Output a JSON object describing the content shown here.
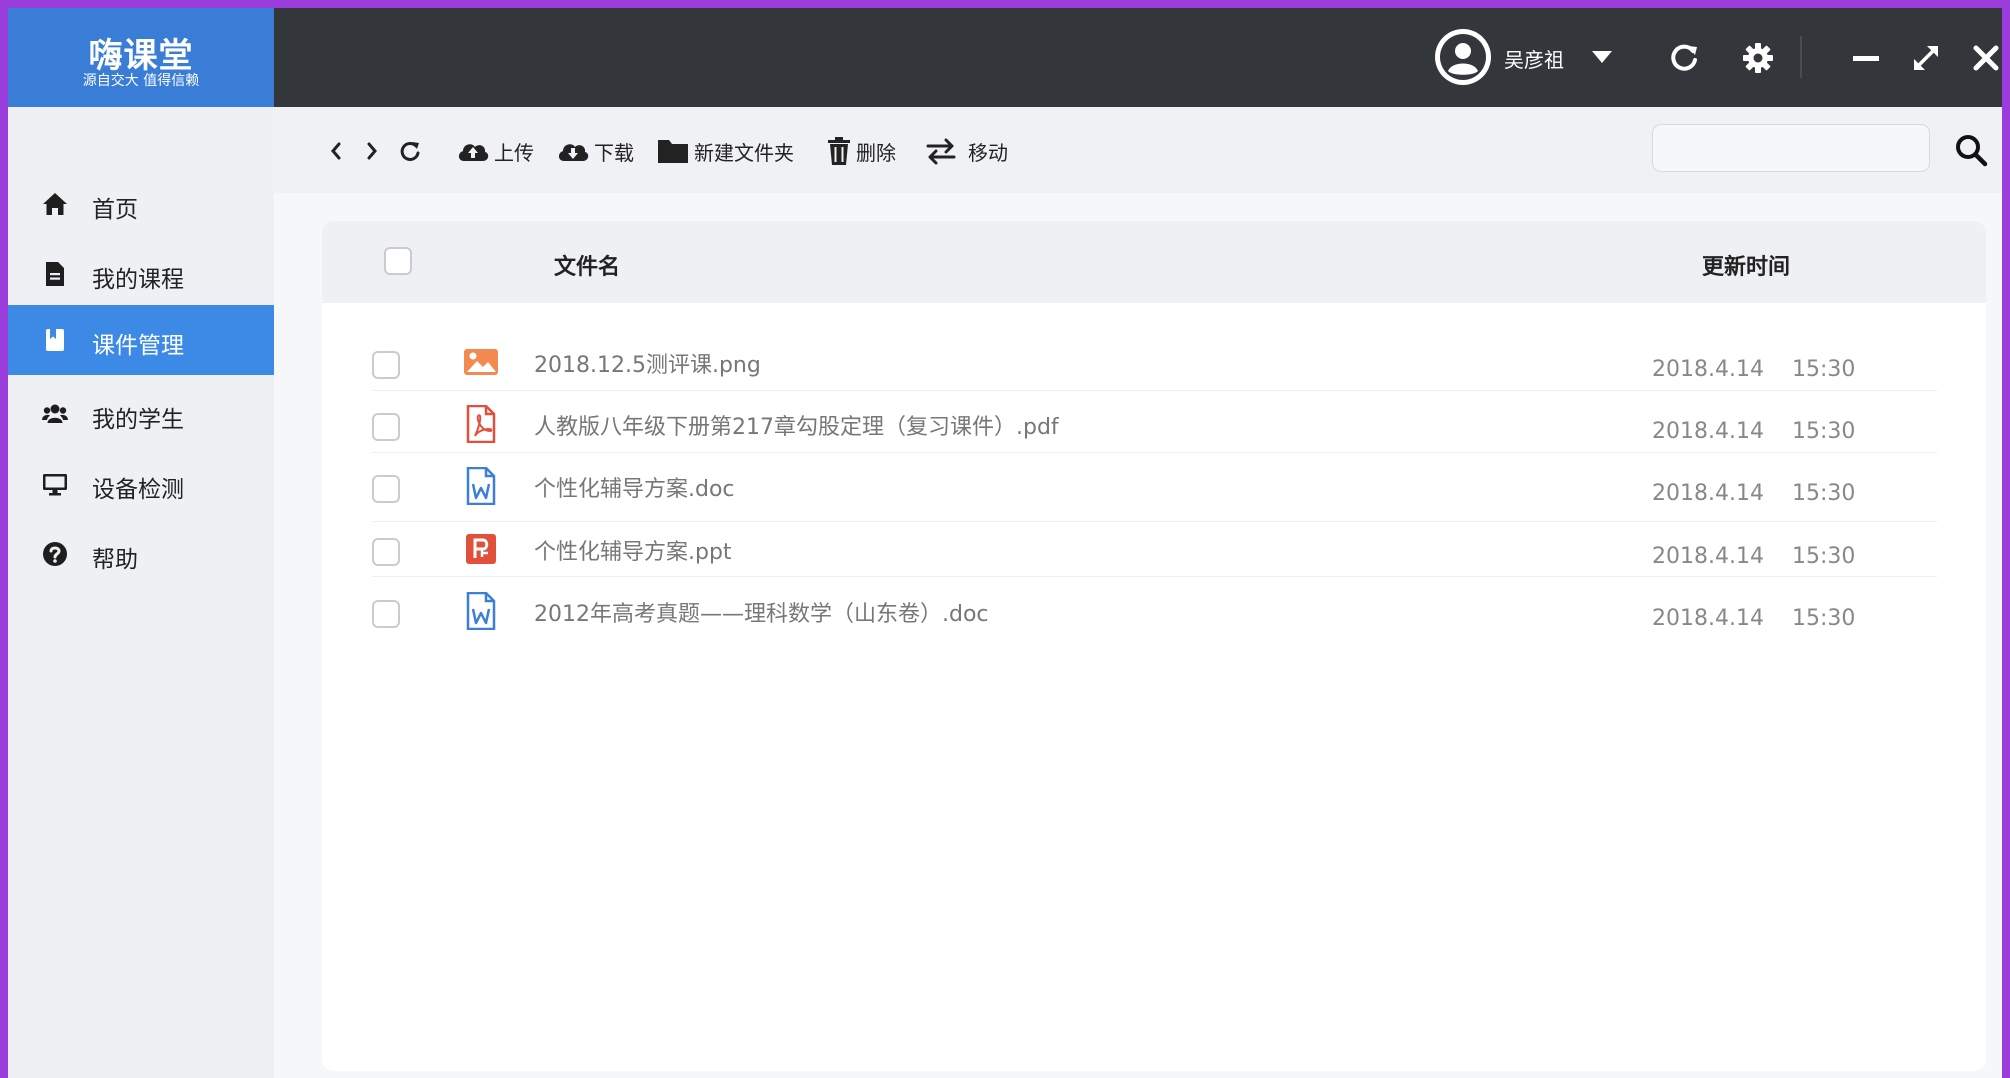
{
  "app": {
    "logo_title": "嗨课堂",
    "logo_subtitle": "源自交大 值得信赖",
    "brand_color": "#3a7dd6",
    "topbar_color": "#33363b",
    "accent_active": "#3d8ae6"
  },
  "header": {
    "user_name": "吴彦祖",
    "icons": [
      "user-avatar-icon",
      "chevron-down-icon",
      "refresh-icon",
      "gear-icon",
      "minimize-icon",
      "expand-icon",
      "close-icon"
    ]
  },
  "sidebar": {
    "items": [
      {
        "label": "首页",
        "icon": "home-icon",
        "active": false
      },
      {
        "label": "我的课程",
        "icon": "document-icon",
        "active": false
      },
      {
        "label": "课件管理",
        "icon": "bookmark-icon",
        "active": true
      },
      {
        "label": "我的学生",
        "icon": "users-icon",
        "active": false
      },
      {
        "label": "设备检测",
        "icon": "monitor-icon",
        "active": false
      },
      {
        "label": "帮助",
        "icon": "help-icon",
        "active": false
      }
    ]
  },
  "toolbar": {
    "upload_label": "上传",
    "download_label": "下载",
    "new_folder_label": "新建文件夹",
    "delete_label": "删除",
    "move_label": "移动",
    "search_placeholder": ""
  },
  "table": {
    "col_name": "文件名",
    "col_time": "更新时间",
    "rows": [
      {
        "name": "2018.12.5测评课.png",
        "type": "image",
        "date": "2018.4.14",
        "time": "15:30"
      },
      {
        "name": "人教版八年级下册第217章勾股定理（复习课件）.pdf",
        "type": "pdf",
        "date": "2018.4.14",
        "time": "15:30"
      },
      {
        "name": "个性化辅导方案.doc",
        "type": "word",
        "date": "2018.4.14",
        "time": "15:30"
      },
      {
        "name": "个性化辅导方案.ppt",
        "type": "ppt",
        "date": "2018.4.14",
        "time": "15:30"
      },
      {
        "name": "2012年高考真题——理科数学（山东卷）.doc",
        "type": "word",
        "date": "2018.4.14",
        "time": "15:30"
      }
    ]
  }
}
